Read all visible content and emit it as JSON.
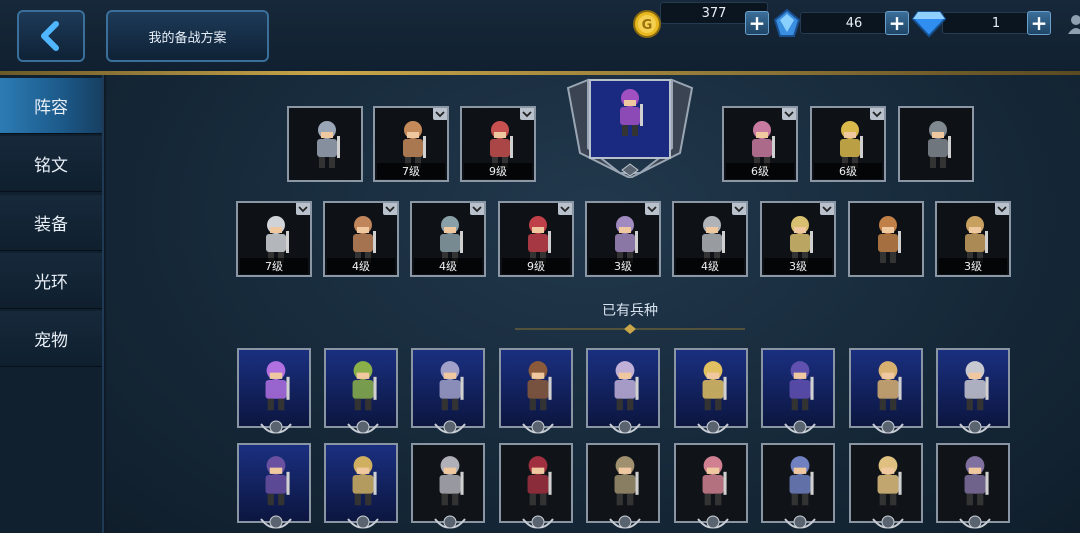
{
  "header": {
    "back_icon": "chevron-left-icon",
    "plan_button_label": "我的备战方案",
    "resources": [
      {
        "icon": "gold-coin-icon",
        "value": "377"
      },
      {
        "icon": "blue-crystal-icon",
        "value": "46"
      },
      {
        "icon": "diamond-icon",
        "value": "1"
      }
    ]
  },
  "sidebar": {
    "items": [
      {
        "label": "阵容",
        "active": true
      },
      {
        "label": "铭文",
        "active": false
      },
      {
        "label": "装备",
        "active": false
      },
      {
        "label": "光环",
        "active": false
      },
      {
        "label": "宠物",
        "active": false
      }
    ]
  },
  "lineup_row1": [
    {
      "level": "",
      "dropdown": false,
      "color": "#9aa6b6"
    },
    {
      "level": "7级",
      "dropdown": true,
      "color": "#c48a5a"
    },
    {
      "level": "9级",
      "dropdown": true,
      "color": "#c75050"
    },
    {
      "level": "6级",
      "dropdown": true,
      "color": "#c87aa0"
    },
    {
      "level": "6级",
      "dropdown": true,
      "color": "#d9b84c"
    },
    {
      "level": "",
      "dropdown": false,
      "color": "#808890"
    }
  ],
  "lineup_row2": [
    {
      "level": "7级",
      "dropdown": true,
      "color": "#d0d4d8"
    },
    {
      "level": "4级",
      "dropdown": true,
      "color": "#c0855a"
    },
    {
      "level": "4级",
      "dropdown": true,
      "color": "#8aa0a8"
    },
    {
      "level": "9级",
      "dropdown": true,
      "color": "#c0404a"
    },
    {
      "level": "3级",
      "dropdown": true,
      "color": "#a08ac0"
    },
    {
      "level": "4级",
      "dropdown": true,
      "color": "#b0b4b8"
    },
    {
      "level": "3级",
      "dropdown": true,
      "color": "#d8c070"
    },
    {
      "level": "",
      "dropdown": false,
      "color": "#c08048"
    },
    {
      "level": "3级",
      "dropdown": true,
      "color": "#c8a060"
    }
  ],
  "leader": {
    "color": "#a050c0"
  },
  "owned_section_title": "已有兵种",
  "owned_row1": [
    {
      "color": "#b070e0"
    },
    {
      "color": "#8ab04a"
    },
    {
      "color": "#a0a0c8"
    },
    {
      "color": "#8a5a3a"
    },
    {
      "color": "#c0b0d8"
    },
    {
      "color": "#e0c060"
    },
    {
      "color": "#6050b0"
    },
    {
      "color": "#d8b070"
    },
    {
      "color": "#c8c8d0"
    }
  ],
  "owned_row2": [
    {
      "color": "#6a50a0",
      "dark": false
    },
    {
      "color": "#d0b060",
      "dark": false
    },
    {
      "color": "#b0b0b8",
      "dark": true
    },
    {
      "color": "#a03040",
      "dark": true
    },
    {
      "color": "#a09070",
      "dark": true
    },
    {
      "color": "#d08090",
      "dark": true
    },
    {
      "color": "#7080c0",
      "dark": true
    },
    {
      "color": "#e0c080",
      "dark": true
    },
    {
      "color": "#8070a0",
      "dark": true
    }
  ],
  "colors": {
    "accent_gold": "#c9a64a",
    "active_tab": "#2c7bb4"
  }
}
